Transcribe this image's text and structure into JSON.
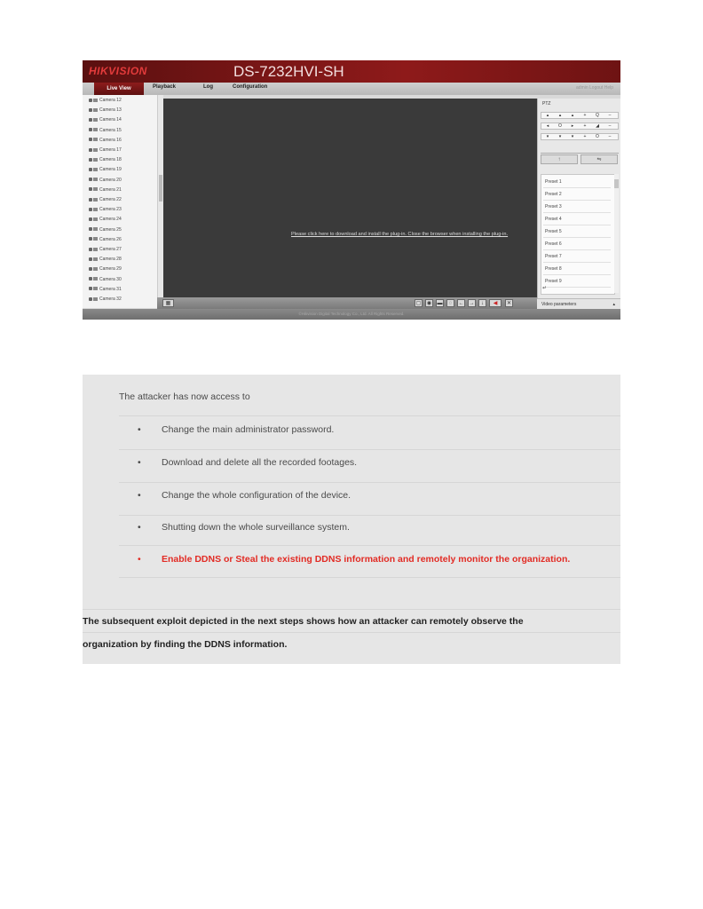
{
  "screenshot": {
    "logo": "HIKVISION",
    "model": "DS-7232HVI-SH",
    "nav": {
      "tabs": [
        "Live View",
        "Playback",
        "Log",
        "Configuration"
      ],
      "right_links": "admin  Logout  Help"
    },
    "cameras": [
      "Camera 12",
      "Camera 13",
      "Camera 14",
      "Camera 15",
      "Camera 16",
      "Camera 17",
      "Camera 18",
      "Camera 19",
      "Camera 20",
      "Camera 21",
      "Camera 22",
      "Camera 23",
      "Camera 24",
      "Camera 25",
      "Camera 26",
      "Camera 27",
      "Camera 28",
      "Camera 29",
      "Camera 30",
      "Camera 31",
      "Camera 32"
    ],
    "plugin_message": "Please click here to download and install the plug-in. Close the browser when installing the plug-in.",
    "ptz": {
      "title": "PTZ",
      "rows": [
        [
          "▴",
          "▴",
          "▴",
          "+",
          "Q",
          "–"
        ],
        [
          "◂",
          "O",
          "▸",
          "+",
          "◢",
          "–"
        ],
        [
          "▾",
          "▾",
          "▾",
          "+",
          "O",
          "–"
        ]
      ],
      "big_buttons": [
        "↑",
        "⇋"
      ]
    },
    "presets": [
      "Preset 1",
      "Preset 2",
      "Preset 3",
      "Preset 4",
      "Preset 5",
      "Preset 6",
      "Preset 7",
      "Preset 8",
      "Preset 9"
    ],
    "preset_go": "↵",
    "video_params_label": "Video parameters",
    "footer": "©Hikvision Digital Technology Co., Ltd. All Rights Reserved."
  },
  "text": {
    "intro": "The attacker has now access to",
    "bullet_char": "•",
    "bullets": [
      {
        "text": "Change the main administrator password.",
        "highlight": false
      },
      {
        "text": "Download and delete all the recorded footages.",
        "highlight": false
      },
      {
        "text": "Change the whole configuration of the device.",
        "highlight": false
      },
      {
        "text": "Shutting down the whole surveillance system.",
        "highlight": false
      },
      {
        "text": "Enable DDNS or Steal the existing DDNS information and remotely monitor the organization.",
        "highlight": true
      }
    ],
    "paragraph_line1": "The subsequent exploit depicted in the next steps shows how an attacker can remotely observe the",
    "paragraph_line2": "organization by finding the DDNS information."
  },
  "colors": {
    "header_red": "#7a1616",
    "highlight_red": "#e22b24",
    "panel_gray": "#e6e6e6"
  }
}
